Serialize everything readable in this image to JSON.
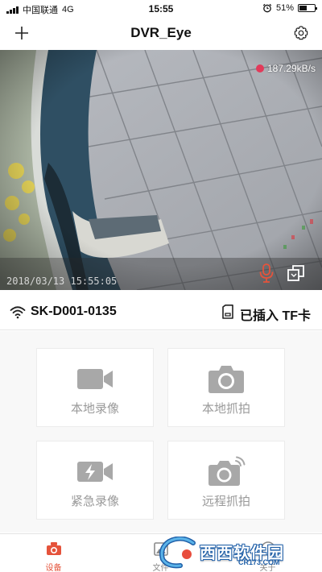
{
  "status_bar": {
    "carrier": "中国联通",
    "network": "4G",
    "time": "15:55",
    "battery_text": "51%",
    "battery_level": 0.51
  },
  "nav": {
    "title": "DVR_Eye",
    "add_icon": "plus-icon",
    "settings_icon": "gear-icon"
  },
  "video": {
    "speed": "187.29kB/s",
    "recording_indicator_color": "#e23a5a",
    "overlay_timestamp": "2018/03/13 15:55:05",
    "mic_icon": "microphone-icon",
    "mic_color": "#e5533b",
    "switch_icon": "switch-camera-icon"
  },
  "device": {
    "name": "SK-D001-0135",
    "tf_status": "已插入 TF卡",
    "wifi_icon": "wifi-icon",
    "sd_icon": "sd-card-icon"
  },
  "actions": [
    {
      "label": "本地录像",
      "icon": "video-camera-icon"
    },
    {
      "label": "本地抓拍",
      "icon": "photo-camera-icon"
    },
    {
      "label": "紧急录像",
      "icon": "emergency-video-icon"
    },
    {
      "label": "远程抓拍",
      "icon": "remote-camera-icon"
    }
  ],
  "tabs": [
    {
      "label": "设备",
      "icon": "dashcam-icon",
      "active": true
    },
    {
      "label": "文件",
      "icon": "file-icon",
      "active": false
    },
    {
      "label": "关于",
      "icon": "info-icon",
      "active": false
    }
  ],
  "colors": {
    "accent": "#e5533b",
    "card_icon": "#a8a8a8",
    "card_label": "#9a9a9a"
  },
  "watermark": {
    "text": "西西软件园",
    "url": "CR173.COM"
  }
}
